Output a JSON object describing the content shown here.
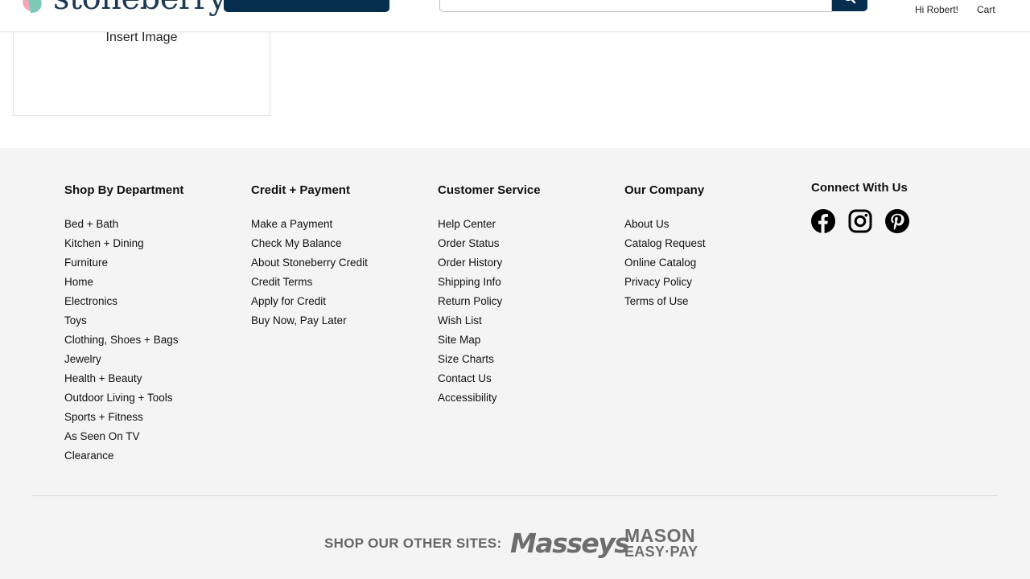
{
  "header": {
    "logo_text": "stoneberry.",
    "greeting": "Hi Robert!",
    "cart_label": "Cart"
  },
  "image_tile": {
    "label": "Insert Image"
  },
  "footer": {
    "columns": [
      {
        "heading": "Shop By Department",
        "links": [
          "Bed + Bath",
          "Kitchen + Dining",
          "Furniture",
          "Home",
          "Electronics",
          "Toys",
          "Clothing, Shoes + Bags",
          "Jewelry",
          "Health + Beauty",
          "Outdoor Living + Tools",
          "Sports + Fitness",
          "As Seen On TV",
          "Clearance"
        ]
      },
      {
        "heading": "Credit + Payment",
        "links": [
          "Make a Payment",
          "Check My Balance",
          "About Stoneberry Credit",
          "Credit Terms",
          "Apply for Credit",
          "Buy Now, Pay Later"
        ]
      },
      {
        "heading": "Customer Service",
        "links": [
          "Help Center",
          "Order Status",
          "Order History",
          "Shipping Info",
          "Return Policy",
          "Wish List",
          "Site Map",
          "Size Charts",
          "Contact Us",
          "Accessibility"
        ]
      },
      {
        "heading": "Our Company",
        "links": [
          "About Us",
          "Catalog Request",
          "Online Catalog",
          "Privacy Policy",
          "Terms of Use"
        ]
      }
    ],
    "connect": {
      "heading": "Connect With Us",
      "icons": [
        "facebook-icon",
        "instagram-icon",
        "pinterest-icon"
      ]
    },
    "other_sites": {
      "label": "SHOP OUR OTHER SITES:",
      "sites": [
        "Masseys",
        "MASON",
        "EASY·PAY"
      ]
    }
  },
  "colors": {
    "brand_navy": "#052e4f",
    "footer_bg": "#f4f4f4",
    "logo_pink": "#f4a6b5",
    "logo_teal": "#7cc9b8"
  }
}
